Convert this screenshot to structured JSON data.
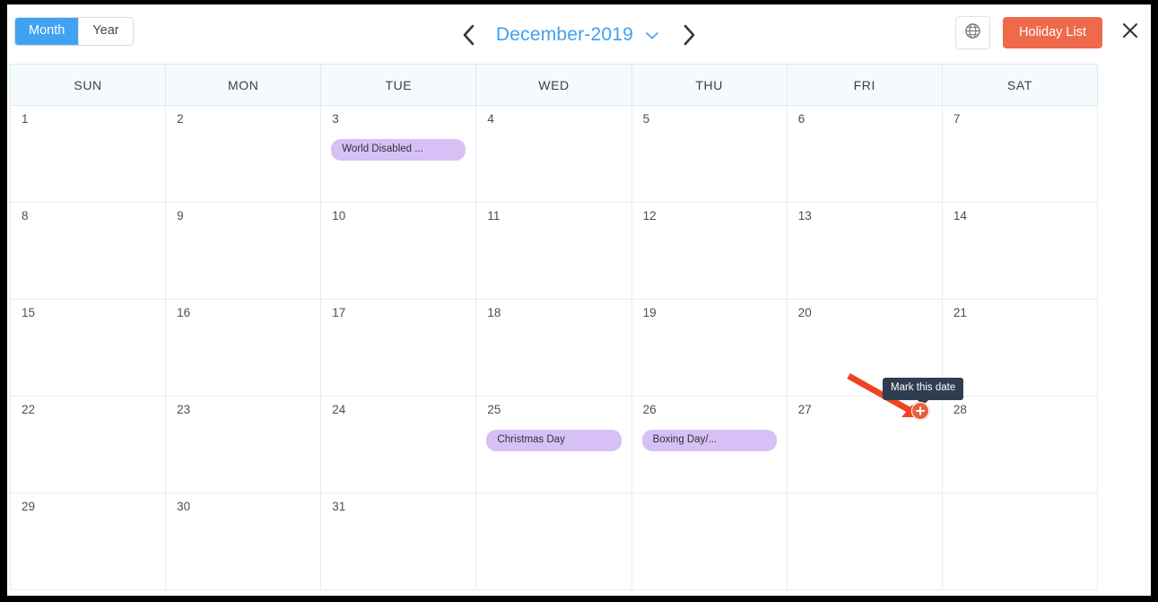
{
  "header": {
    "view_toggle": {
      "month_label": "Month",
      "year_label": "Year",
      "active": "Month"
    },
    "prev_icon": "chevron-left-icon",
    "next_icon": "chevron-right-icon",
    "title": "December-2019",
    "title_caret_icon": "chevron-down-icon",
    "globe_icon": "globe-icon",
    "holiday_list_label": "Holiday List",
    "close_icon": "close-icon",
    "accent_blue": "#40a2f0",
    "accent_orange": "#ee6a4b"
  },
  "calendar": {
    "weekdays": [
      "SUN",
      "MON",
      "TUE",
      "WED",
      "THU",
      "FRI",
      "SAT"
    ],
    "weeks": [
      [
        {
          "day": "1",
          "events": []
        },
        {
          "day": "2",
          "events": []
        },
        {
          "day": "3",
          "events": [
            "World Disabled ..."
          ]
        },
        {
          "day": "4",
          "events": []
        },
        {
          "day": "5",
          "events": []
        },
        {
          "day": "6",
          "events": []
        },
        {
          "day": "7",
          "events": []
        }
      ],
      [
        {
          "day": "8",
          "events": []
        },
        {
          "day": "9",
          "events": []
        },
        {
          "day": "10",
          "events": []
        },
        {
          "day": "11",
          "events": []
        },
        {
          "day": "12",
          "events": []
        },
        {
          "day": "13",
          "events": []
        },
        {
          "day": "14",
          "events": []
        }
      ],
      [
        {
          "day": "15",
          "events": []
        },
        {
          "day": "16",
          "events": []
        },
        {
          "day": "17",
          "events": []
        },
        {
          "day": "18",
          "events": []
        },
        {
          "day": "19",
          "events": []
        },
        {
          "day": "20",
          "events": []
        },
        {
          "day": "21",
          "events": []
        }
      ],
      [
        {
          "day": "22",
          "events": []
        },
        {
          "day": "23",
          "events": []
        },
        {
          "day": "24",
          "events": []
        },
        {
          "day": "25",
          "events": [
            "Christmas Day"
          ]
        },
        {
          "day": "26",
          "events": [
            "Boxing Day/..."
          ]
        },
        {
          "day": "27",
          "events": []
        },
        {
          "day": "28",
          "events": []
        }
      ],
      [
        {
          "day": "29",
          "events": []
        },
        {
          "day": "30",
          "events": []
        },
        {
          "day": "31",
          "events": []
        },
        {
          "day": "",
          "events": []
        },
        {
          "day": "",
          "events": []
        },
        {
          "day": "",
          "events": []
        },
        {
          "day": "",
          "events": []
        }
      ]
    ],
    "event_chip_color": "#d7c0f5"
  },
  "overlay": {
    "tooltip_text": "Mark this date",
    "tooltip_bg": "#2f3d4f",
    "mark_button_icon": "plus-icon",
    "mark_button_color": "#e9603e",
    "annotation_arrow_icon": "arrow-pointer-icon",
    "annotation_arrow_color": "#ef4422"
  }
}
